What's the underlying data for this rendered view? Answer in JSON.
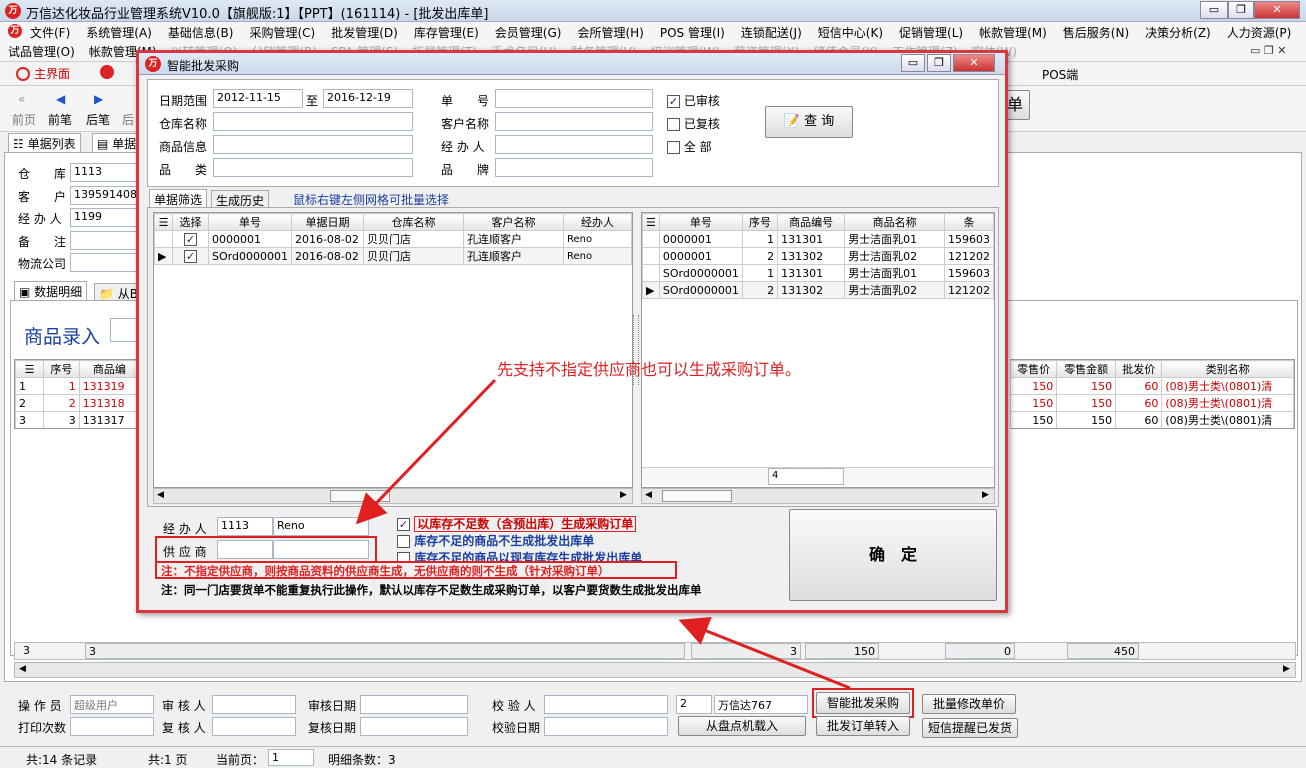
{
  "window": {
    "title": "万信达化妆品行业管理系统V10.0【旗舰版:1】【PPT】(161114) - [批发出库单]",
    "controls": [
      "▭",
      "❐",
      "✕"
    ]
  },
  "menu": {
    "row1": [
      "文件(F)",
      "系统管理(A)",
      "基础信息(B)",
      "采购管理(C)",
      "批发管理(D)",
      "库存管理(E)",
      "会员管理(G)",
      "会所管理(H)",
      "POS 管理(I)",
      "连锁配送(J)",
      "短信中心(K)",
      "促销管理(L)",
      "帐款管理(M)",
      "售后服务(N)",
      "决策分析(Z)",
      "人力资源(P)"
    ],
    "row2": [
      "试品管理(O)",
      "帐款管理(M)",
      "以转管理(Q)",
      "分销管理(R)",
      "SPA 管理(S)",
      "拓展管理(T)",
      "手术名目(U)",
      "财务管理(V)",
      "培训管理(W)",
      "薪资管理(X)",
      "储值会员(Y)",
      "工作管理(Z)",
      "窗体(W)"
    ]
  },
  "toolbar": {
    "home": "主界面",
    "pos": "POS端",
    "single": "单"
  },
  "nav": {
    "first": "前页",
    "prev": "前笔",
    "next": "后笔",
    "last": "后"
  },
  "tabs": {
    "list": "单据列表",
    "doc": "单据"
  },
  "form": {
    "warehouse_label": "仓　　库",
    "warehouse": "1113",
    "customer_label": "客　　户",
    "customer": "139591408188",
    "handler_label": "经 办 人",
    "handler": "1199",
    "note_label": "备　　注",
    "logistics_label": "物流公司"
  },
  "detail_tabs": {
    "data": "数据明细",
    "from": "从B"
  },
  "product_entry": "商品录入",
  "main_grid": {
    "headers_left": [
      "序号",
      "商品编"
    ],
    "headers_right": [
      "零售价",
      "零售金额",
      "批发价",
      "类别名称"
    ],
    "rows": [
      {
        "idx": "1",
        "no": "1",
        "code": "131319",
        "price": "150",
        "amount": "150",
        "wholesale": "60",
        "cat": "(08)男士类\\(0801)清"
      },
      {
        "idx": "2",
        "no": "2",
        "code": "131318",
        "price": "150",
        "amount": "150",
        "wholesale": "60",
        "cat": "(08)男士类\\(0801)清"
      },
      {
        "idx": "3",
        "no": "3",
        "code": "131317",
        "price": "150",
        "amount": "150",
        "wholesale": "60",
        "cat": "(08)男士类\\(0801)清"
      }
    ],
    "footer": {
      "a": "3",
      "b": "3",
      "c": "3",
      "d": "150",
      "e": "0",
      "f": "450"
    }
  },
  "bottom": {
    "operator_label": "操 作 员",
    "operator": "超级用户",
    "auditor_label": "审 核 人",
    "audit_date_label": "审核日期",
    "checker_label": "校 验 人",
    "print_label": "打印次数",
    "reviewer_label": "复 核 人",
    "review_date_label": "复核日期",
    "check_date_label": "校验日期",
    "company_no": "2",
    "company": "万信达767",
    "btn_smart": "智能批发采购",
    "btn_batch": "批量修改单价",
    "btn_load": "从盘点机载入",
    "btn_order": "批发订单转入",
    "btn_sms": "短信提醒已发货"
  },
  "status": {
    "records": "共:14 条记录",
    "pages": "共:1 页",
    "current_label": "当前页：",
    "current": "1",
    "detail": "明细条数：3"
  },
  "dialog": {
    "title": "智能批发采购",
    "date_label": "日期范围",
    "date_from": "2012-11-15",
    "date_to_label": "至",
    "date_to": "2016-12-19",
    "doc_no_label": "单　　号",
    "warehouse_label": "仓库名称",
    "customer_label": "客户名称",
    "product_label": "商品信息",
    "handler_label": "经 办 人",
    "category_label": "品　　类",
    "brand_label": "品　　牌",
    "chk_audited": "已审核",
    "chk_reviewed": "已复核",
    "chk_all": "全 部",
    "query": "查 询",
    "tab_filter": "单据筛选",
    "tab_history": "生成历史",
    "hint": "鼠标右键左侧网格可批量选择",
    "left_headers": [
      "选择",
      "单号",
      "单据日期",
      "仓库名称",
      "客户名称",
      "经办人"
    ],
    "left_rows": [
      {
        "no": "0000001",
        "date": "2016-08-02",
        "wh": "贝贝门店",
        "cust": "孔连顺客户",
        "h": "Reno"
      },
      {
        "no": "SOrd0000001",
        "date": "2016-08-02",
        "wh": "贝贝门店",
        "cust": "孔连顺客户",
        "h": "Reno"
      }
    ],
    "right_headers": [
      "单号",
      "序号",
      "商品编号",
      "商品名称",
      "条"
    ],
    "right_rows": [
      {
        "no": "0000001",
        "seq": "1",
        "code": "131301",
        "name": "男士洁面乳01",
        "bar": "159603"
      },
      {
        "no": "0000001",
        "seq": "2",
        "code": "131302",
        "name": "男士洁面乳02",
        "bar": "121202"
      },
      {
        "no": "SOrd0000001",
        "seq": "1",
        "code": "131301",
        "name": "男士洁面乳01",
        "bar": "159603"
      },
      {
        "no": "SOrd0000001",
        "seq": "2",
        "code": "131302",
        "name": "男士洁面乳02",
        "bar": "121202"
      }
    ],
    "right_footer": "4",
    "annotation": "先支持不指定供应商也可以生成采购订单。",
    "handler_code": "1113",
    "handler_name": "Reno",
    "supplier_label": "供 应 商",
    "opt1": "以库存不足数（含预出库）生成采购订单",
    "opt2": "库存不足的商品不生成批发出库单",
    "opt3": "库存不足的商品以现有库存生成批发出库单",
    "note_red": "注：不指定供应商，则按商品资料的供应商生成，无供应商的则不生成（针对采购订单）",
    "note_black": "注：同一门店要货单不能重复执行此操作，默认以库存不足数生成采购订单，以客户要货数生成批发出库单",
    "confirm": "确　定"
  },
  "colors": {
    "accent_red": "#e02020",
    "title_blue": "#1a3fa0"
  }
}
